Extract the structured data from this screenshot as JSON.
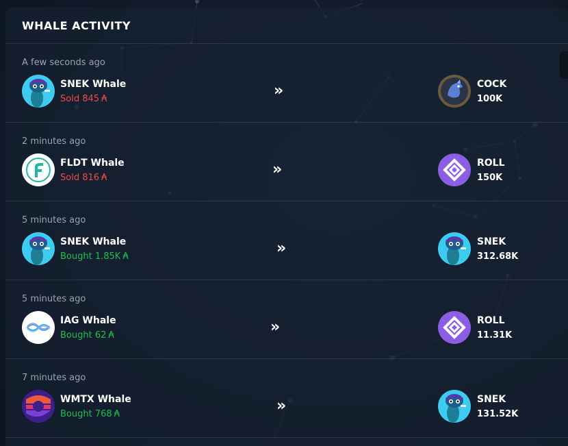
{
  "panel": {
    "title": "WHALE ACTIVITY"
  },
  "currency_symbol": "₳",
  "rows": [
    {
      "time": "A few seconds ago",
      "whale": "SNEK Whale",
      "whale_icon": "snek-icon",
      "action": "Sold",
      "amount": "845",
      "token": "COCK",
      "token_icon": "cock-icon",
      "token_amount": "100K"
    },
    {
      "time": "2 minutes ago",
      "whale": "FLDT Whale",
      "whale_icon": "fldt-icon",
      "action": "Sold",
      "amount": "816",
      "token": "ROLL",
      "token_icon": "roll-icon",
      "token_amount": "150K"
    },
    {
      "time": "5 minutes ago",
      "whale": "SNEK Whale",
      "whale_icon": "snek-icon",
      "action": "Bought",
      "amount": "1.85K",
      "token": "SNEK",
      "token_icon": "snek-icon",
      "token_amount": "312.68K"
    },
    {
      "time": "5 minutes ago",
      "whale": "IAG Whale",
      "whale_icon": "iag-icon",
      "action": "Bought",
      "amount": "62",
      "token": "ROLL",
      "token_icon": "roll-icon",
      "token_amount": "11.31K"
    },
    {
      "time": "7 minutes ago",
      "whale": "WMTX Whale",
      "whale_icon": "wmtx-icon",
      "action": "Bought",
      "amount": "768",
      "token": "SNEK",
      "token_icon": "snek-icon",
      "token_amount": "131.52K"
    }
  ],
  "arrow_glyph": "»",
  "colors": {
    "sold": "#f04a4a",
    "bought": "#1fbf4f",
    "panel": "#162132"
  }
}
